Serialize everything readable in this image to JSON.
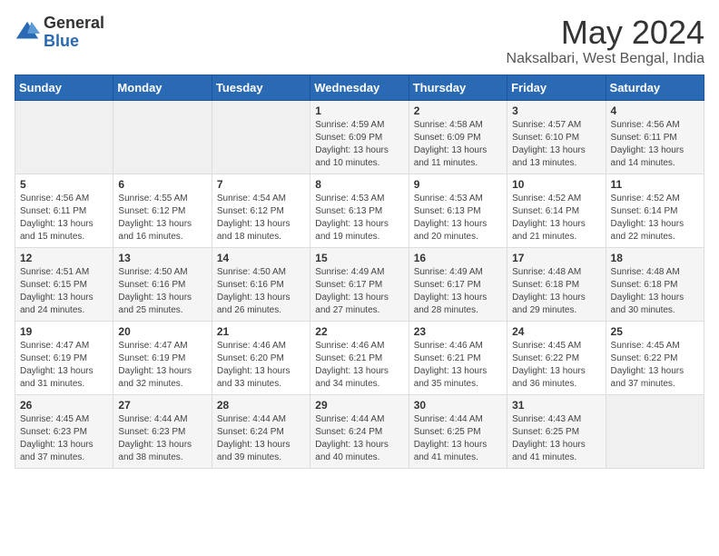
{
  "logo": {
    "general": "General",
    "blue": "Blue"
  },
  "title": "May 2024",
  "subtitle": "Naksalbari, West Bengal, India",
  "days_of_week": [
    "Sunday",
    "Monday",
    "Tuesday",
    "Wednesday",
    "Thursday",
    "Friday",
    "Saturday"
  ],
  "weeks": [
    [
      {
        "day": "",
        "info": ""
      },
      {
        "day": "",
        "info": ""
      },
      {
        "day": "",
        "info": ""
      },
      {
        "day": "1",
        "info": "Sunrise: 4:59 AM\nSunset: 6:09 PM\nDaylight: 13 hours and 10 minutes."
      },
      {
        "day": "2",
        "info": "Sunrise: 4:58 AM\nSunset: 6:09 PM\nDaylight: 13 hours and 11 minutes."
      },
      {
        "day": "3",
        "info": "Sunrise: 4:57 AM\nSunset: 6:10 PM\nDaylight: 13 hours and 13 minutes."
      },
      {
        "day": "4",
        "info": "Sunrise: 4:56 AM\nSunset: 6:11 PM\nDaylight: 13 hours and 14 minutes."
      }
    ],
    [
      {
        "day": "5",
        "info": "Sunrise: 4:56 AM\nSunset: 6:11 PM\nDaylight: 13 hours and 15 minutes."
      },
      {
        "day": "6",
        "info": "Sunrise: 4:55 AM\nSunset: 6:12 PM\nDaylight: 13 hours and 16 minutes."
      },
      {
        "day": "7",
        "info": "Sunrise: 4:54 AM\nSunset: 6:12 PM\nDaylight: 13 hours and 18 minutes."
      },
      {
        "day": "8",
        "info": "Sunrise: 4:53 AM\nSunset: 6:13 PM\nDaylight: 13 hours and 19 minutes."
      },
      {
        "day": "9",
        "info": "Sunrise: 4:53 AM\nSunset: 6:13 PM\nDaylight: 13 hours and 20 minutes."
      },
      {
        "day": "10",
        "info": "Sunrise: 4:52 AM\nSunset: 6:14 PM\nDaylight: 13 hours and 21 minutes."
      },
      {
        "day": "11",
        "info": "Sunrise: 4:52 AM\nSunset: 6:14 PM\nDaylight: 13 hours and 22 minutes."
      }
    ],
    [
      {
        "day": "12",
        "info": "Sunrise: 4:51 AM\nSunset: 6:15 PM\nDaylight: 13 hours and 24 minutes."
      },
      {
        "day": "13",
        "info": "Sunrise: 4:50 AM\nSunset: 6:16 PM\nDaylight: 13 hours and 25 minutes."
      },
      {
        "day": "14",
        "info": "Sunrise: 4:50 AM\nSunset: 6:16 PM\nDaylight: 13 hours and 26 minutes."
      },
      {
        "day": "15",
        "info": "Sunrise: 4:49 AM\nSunset: 6:17 PM\nDaylight: 13 hours and 27 minutes."
      },
      {
        "day": "16",
        "info": "Sunrise: 4:49 AM\nSunset: 6:17 PM\nDaylight: 13 hours and 28 minutes."
      },
      {
        "day": "17",
        "info": "Sunrise: 4:48 AM\nSunset: 6:18 PM\nDaylight: 13 hours and 29 minutes."
      },
      {
        "day": "18",
        "info": "Sunrise: 4:48 AM\nSunset: 6:18 PM\nDaylight: 13 hours and 30 minutes."
      }
    ],
    [
      {
        "day": "19",
        "info": "Sunrise: 4:47 AM\nSunset: 6:19 PM\nDaylight: 13 hours and 31 minutes."
      },
      {
        "day": "20",
        "info": "Sunrise: 4:47 AM\nSunset: 6:19 PM\nDaylight: 13 hours and 32 minutes."
      },
      {
        "day": "21",
        "info": "Sunrise: 4:46 AM\nSunset: 6:20 PM\nDaylight: 13 hours and 33 minutes."
      },
      {
        "day": "22",
        "info": "Sunrise: 4:46 AM\nSunset: 6:21 PM\nDaylight: 13 hours and 34 minutes."
      },
      {
        "day": "23",
        "info": "Sunrise: 4:46 AM\nSunset: 6:21 PM\nDaylight: 13 hours and 35 minutes."
      },
      {
        "day": "24",
        "info": "Sunrise: 4:45 AM\nSunset: 6:22 PM\nDaylight: 13 hours and 36 minutes."
      },
      {
        "day": "25",
        "info": "Sunrise: 4:45 AM\nSunset: 6:22 PM\nDaylight: 13 hours and 37 minutes."
      }
    ],
    [
      {
        "day": "26",
        "info": "Sunrise: 4:45 AM\nSunset: 6:23 PM\nDaylight: 13 hours and 37 minutes."
      },
      {
        "day": "27",
        "info": "Sunrise: 4:44 AM\nSunset: 6:23 PM\nDaylight: 13 hours and 38 minutes."
      },
      {
        "day": "28",
        "info": "Sunrise: 4:44 AM\nSunset: 6:24 PM\nDaylight: 13 hours and 39 minutes."
      },
      {
        "day": "29",
        "info": "Sunrise: 4:44 AM\nSunset: 6:24 PM\nDaylight: 13 hours and 40 minutes."
      },
      {
        "day": "30",
        "info": "Sunrise: 4:44 AM\nSunset: 6:25 PM\nDaylight: 13 hours and 41 minutes."
      },
      {
        "day": "31",
        "info": "Sunrise: 4:43 AM\nSunset: 6:25 PM\nDaylight: 13 hours and 41 minutes."
      },
      {
        "day": "",
        "info": ""
      }
    ]
  ]
}
